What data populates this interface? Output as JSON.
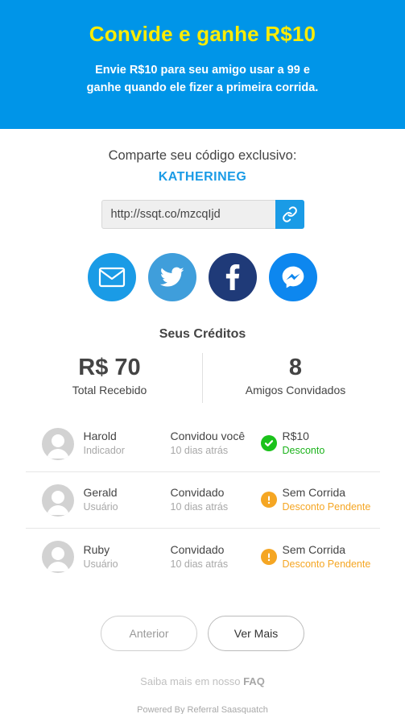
{
  "header": {
    "title": "Convide e ganhe R$10",
    "subtitle_line1": "Envie R$10 para seu amigo usar a 99 e",
    "subtitle_line2": "ganhe quando ele fizer a primeira corrida."
  },
  "share": {
    "intro": "Comparte seu código exclusivo:",
    "code": "KATHERINEG",
    "link": "http://ssqt.co/mzcqIjd",
    "copy_icon": "link-icon"
  },
  "social": [
    {
      "name": "email",
      "icon": "envelope-icon",
      "color": "#1a9be6"
    },
    {
      "name": "twitter",
      "icon": "twitter-icon",
      "color": "#3f9edb"
    },
    {
      "name": "facebook",
      "icon": "facebook-icon",
      "color": "#1f3a78"
    },
    {
      "name": "messenger",
      "icon": "messenger-icon",
      "color": "#0d87ef"
    }
  ],
  "credits": {
    "title": "Seus Créditos",
    "total_value": "R$ 70",
    "total_label": "Total Recebido",
    "friends_value": "8",
    "friends_label": "Amigos Convidados"
  },
  "referrals": [
    {
      "name": "Harold",
      "role": "Indicador",
      "action": "Convidou você",
      "time": "10 dias atrás",
      "status": "R$10",
      "status_detail": "Desconto",
      "state": "ok"
    },
    {
      "name": "Gerald",
      "role": "Usuário",
      "action": "Convidado",
      "time": "10 dias atrás",
      "status": "Sem Corrida",
      "status_detail": "Desconto Pendente",
      "state": "pending"
    },
    {
      "name": "Ruby",
      "role": "Usuário",
      "action": "Convidado",
      "time": "10 dias atrás",
      "status": "Sem Corrida",
      "status_detail": "Desconto Pendente",
      "state": "pending"
    }
  ],
  "pager": {
    "prev": "Anterior",
    "next": "Ver Mais"
  },
  "footer": {
    "faq_prefix": "Saiba mais em nosso",
    "faq_link": "FAQ",
    "powered": "Powered By Referral Saasquatch"
  },
  "colors": {
    "brand": "#0095e8",
    "title": "#ffec00",
    "success": "#1bc21b",
    "warning": "#f5a623"
  }
}
